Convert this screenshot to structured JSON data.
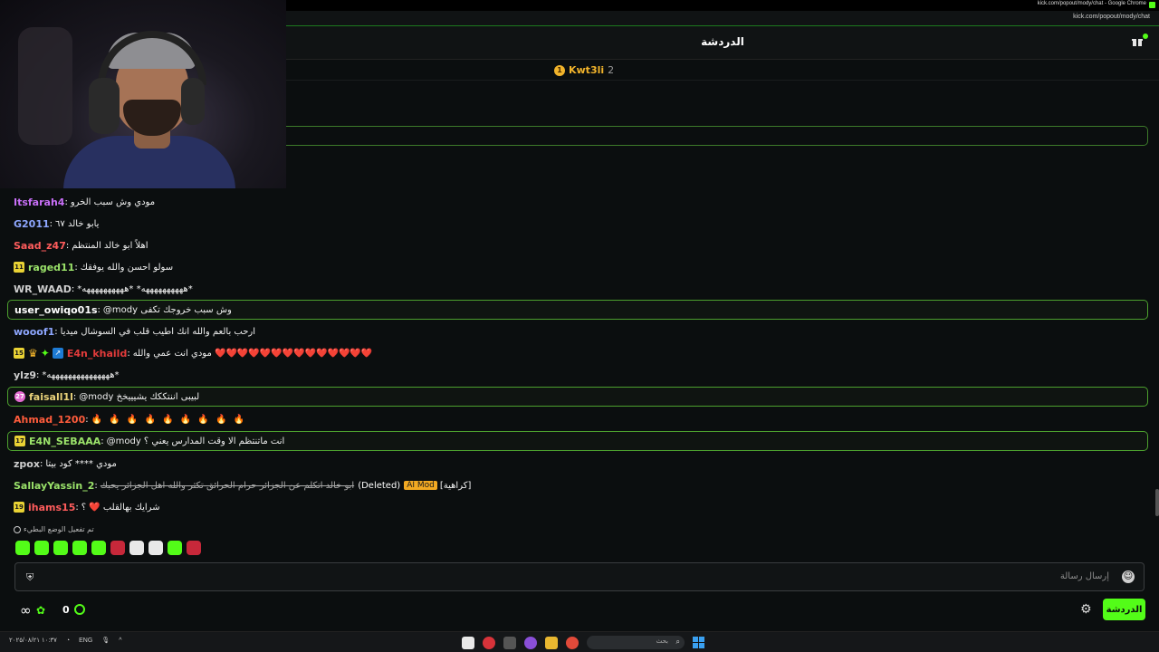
{
  "window": {
    "title": "kick.com/popout/mody/chat - Google Chrome",
    "url": "kick.com/popout/mody/chat"
  },
  "header": {
    "title": "الدردشة",
    "gift_icon": "gift-icon"
  },
  "leaderboard": {
    "rank": "1",
    "username": "Kwt3li",
    "count": "2"
  },
  "messages": [
    {
      "user": "Itsfarah4",
      "user_color": "#c86ff7",
      "text": "مودي وش سبب الخرو",
      "highlight": false,
      "badges": []
    },
    {
      "user": "G2011",
      "user_color": "#8ea7ff",
      "text": "يابو خالد ٦٧",
      "highlight": false,
      "badges": []
    },
    {
      "user": "Saad_z47",
      "user_color": "#ff5c5c",
      "text": "اهلاً ابو خالد المنتظم",
      "highlight": false,
      "badges": []
    },
    {
      "user": "raged11",
      "user_color": "#9be36a",
      "text": "سولو احسن والله يوفقك",
      "highlight": false,
      "badges": [
        "11"
      ]
    },
    {
      "user": "WR_WAAD",
      "user_color": "#cfcfcf",
      "text": "*ههههههههههه* *ههههههههههه*",
      "highlight": false,
      "badges": []
    },
    {
      "user": "user_owiqo01s",
      "user_color": "#ffffff",
      "text": "@mody وش سبب خروجك تكفى",
      "highlight": true,
      "badges": []
    },
    {
      "user": "wooof1",
      "user_color": "#8ea7ff",
      "text": "ارحب بالعم والله انك اطيب قلب في السوشال ميديا",
      "highlight": false,
      "badges": []
    },
    {
      "user": "E4n_khaild",
      "user_color": "#e23b3b",
      "text": "مودي انت عمي والله ❤️❤️❤️❤️❤️❤️❤️❤️❤️❤️❤️❤️❤️❤️",
      "highlight": false,
      "badges": [
        "15"
      ]
    },
    {
      "user": "ylz9",
      "user_color": "#cfcfcf",
      "text": "*هههههههههههههههه*",
      "highlight": false,
      "badges": []
    },
    {
      "user": "faisall1l",
      "user_color": "#e8d27a",
      "text": "@mody لبيبى اننتككك يشيييخخ",
      "highlight": true,
      "badges": [
        "27"
      ]
    },
    {
      "user": "Ahmad_1200",
      "user_color": "#ff5c3c",
      "text": "🔥 🔥 🔥 🔥 🔥 🔥 🔥 🔥 🔥",
      "highlight": false,
      "badges": []
    },
    {
      "user": "E4N_SEBAAA",
      "user_color": "#9be36a",
      "text": "@mody انت ماتنتظم الا وقت المدارس يعني ؟",
      "highlight": true,
      "badges": [
        "17"
      ]
    },
    {
      "user": "zpox",
      "user_color": "#cfcfcf",
      "text": "مودي **** كود بيتا",
      "highlight": false,
      "badges": []
    },
    {
      "user": "SallayYassin_2",
      "user_color": "#9be36a",
      "text": "ابو خالد اتكلم عن الجزائر حرام الحرائق تكثر والله اهل الجزائر يحبك",
      "highlight": false,
      "badges": [],
      "deleted": true,
      "deleted_label": "(Deleted)",
      "mod_label": "AI Mod",
      "reason": "[كراهية]"
    },
    {
      "user": "ihams15",
      "user_color": "#ff5c5c",
      "text": "شرايك بهالقلب ❤️ ؟",
      "highlight": false,
      "badges": [
        "19"
      ]
    }
  ],
  "notice": "تم تفعيل الوضع البطيء",
  "input": {
    "placeholder": "إرسال رسالة"
  },
  "bottom": {
    "infinity": "∞",
    "points": "0",
    "chat_button": "الدردشة"
  },
  "taskbar": {
    "lang": "ENG",
    "search_placeholder": "بحث",
    "time": "١٠:٣٧",
    "date": "٢٠٢٥/٠٨/٢١"
  },
  "colors": {
    "accent": "#53fc18",
    "background": "#0b0e0f",
    "highlight_border": "#4ca02e"
  }
}
